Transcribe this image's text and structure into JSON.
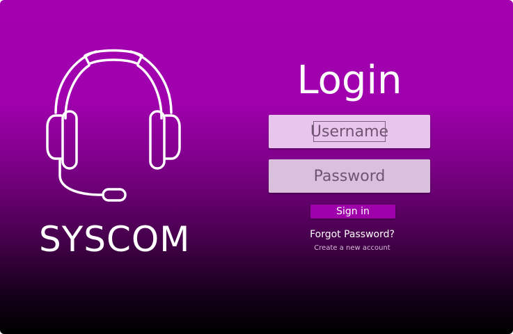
{
  "brand": {
    "name": "SYSCOM",
    "logo_icon": "headset-icon"
  },
  "login": {
    "title": "Login",
    "username_placeholder": "Username",
    "password_placeholder": "Password",
    "sign_in_label": "Sign in",
    "forgot_password_label": "Forgot Password?",
    "create_account_label": "Create a new account"
  },
  "colors": {
    "accent": "#a300b0",
    "button": "#9e00aa",
    "field_bg": "#e8c5ec"
  }
}
